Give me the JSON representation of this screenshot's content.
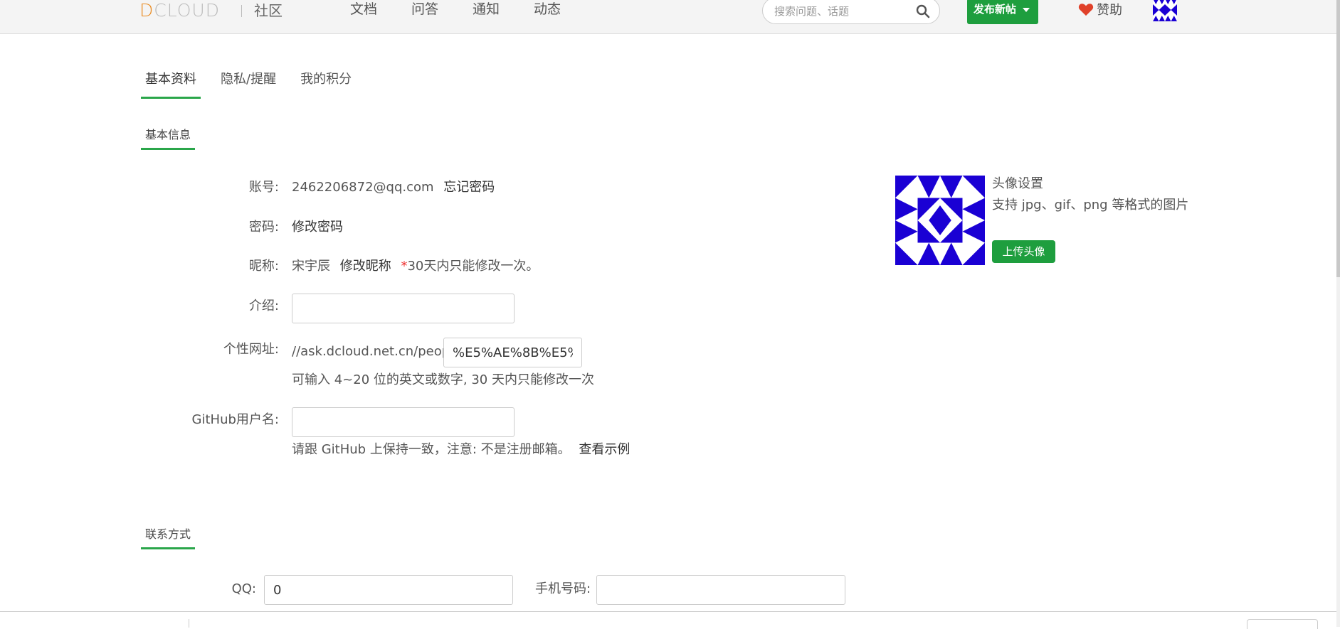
{
  "header": {
    "logo_d": "D",
    "logo_rest": "CLOUD",
    "logo_sub": "社区",
    "nav": [
      "文档",
      "问答",
      "通知",
      "动态"
    ],
    "search_placeholder": "搜索问题、话题",
    "post_button": "发布新帖",
    "sponsor": "赞助"
  },
  "tabs": [
    {
      "label": "基本资料",
      "active": true
    },
    {
      "label": "隐私/提醒",
      "active": false
    },
    {
      "label": "我的积分",
      "active": false
    }
  ],
  "basic": {
    "section_title": "基本信息",
    "account_label": "账号:",
    "account_value": "2462206872@qq.com",
    "forgot_password": "忘记密码",
    "password_label": "密码:",
    "change_password": "修改密码",
    "nickname_label": "昵称:",
    "nickname_value": "宋宇辰",
    "change_nickname": "修改昵称",
    "nickname_star": "*",
    "nickname_note": "30天内只能修改一次。",
    "intro_label": "介绍:",
    "intro_value": "",
    "url_label": "个性网址:",
    "url_prefix": "//ask.dcloud.net.cn/people/",
    "url_value": "%E5%AE%8B%E5%",
    "url_hint": "可输入 4~20 位的英文或数字, 30 天内只能修改一次",
    "github_label": "GitHub用户名:",
    "github_value": "",
    "github_hint": "请跟 GitHub 上保持一致，注意: 不是注册邮箱。",
    "github_example": "查看示例"
  },
  "avatar": {
    "title": "头像设置",
    "desc": "支持 jpg、gif、png 等格式的图片",
    "upload_button": "上传头像"
  },
  "contact": {
    "section_title": "联系方式",
    "qq_label": "QQ:",
    "qq_value": "0",
    "phone_label": "手机号码:",
    "phone_value": ""
  },
  "colors": {
    "accent": "#2aa64a",
    "button_green": "#1e9e3e",
    "avatar_blue": "#1a00d4",
    "heart": "#e0412a",
    "logo_orange": "#e98a1f"
  }
}
